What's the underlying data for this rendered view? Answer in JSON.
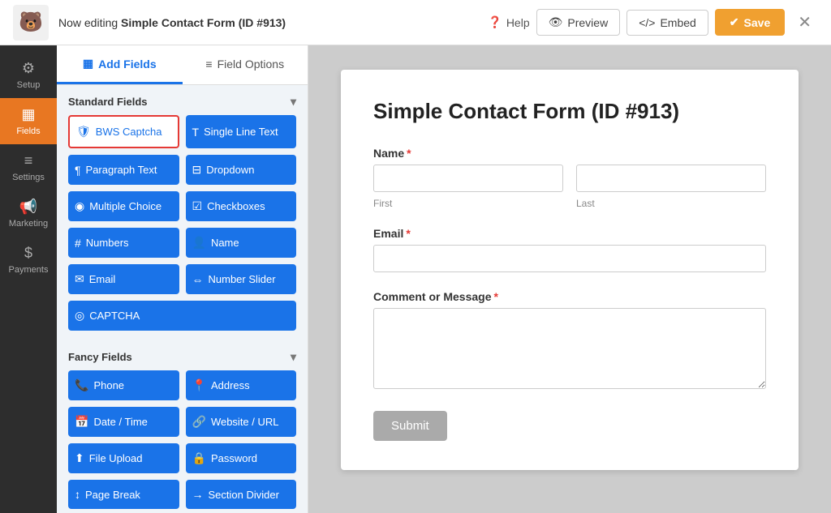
{
  "topbar": {
    "logo": "🐻",
    "editing_label": "Now editing",
    "form_name": "Simple Contact Form (ID #913)",
    "help_label": "Help",
    "preview_label": "Preview",
    "embed_label": "Embed",
    "save_label": "Save"
  },
  "sidebar_nav": {
    "items": [
      {
        "id": "setup",
        "label": "Setup",
        "icon": "⚙"
      },
      {
        "id": "fields",
        "label": "Fields",
        "icon": "▦",
        "active": true
      },
      {
        "id": "settings",
        "label": "Settings",
        "icon": "≡"
      },
      {
        "id": "marketing",
        "label": "Marketing",
        "icon": "📢"
      },
      {
        "id": "payments",
        "label": "Payments",
        "icon": "$"
      }
    ]
  },
  "panel": {
    "tabs": [
      {
        "id": "add-fields",
        "label": "Add Fields",
        "active": true
      },
      {
        "id": "field-options",
        "label": "Field Options"
      }
    ],
    "standard_fields_label": "Standard Fields",
    "fancy_fields_label": "Fancy Fields",
    "standard_fields": [
      {
        "id": "bws-captcha",
        "label": "BWS Captcha",
        "icon": "🛡",
        "selected": true
      },
      {
        "id": "single-line-text",
        "label": "Single Line Text",
        "icon": "T"
      },
      {
        "id": "paragraph-text",
        "label": "Paragraph Text",
        "icon": "¶"
      },
      {
        "id": "dropdown",
        "label": "Dropdown",
        "icon": "⊟"
      },
      {
        "id": "multiple-choice",
        "label": "Multiple Choice",
        "icon": "◉"
      },
      {
        "id": "checkboxes",
        "label": "Checkboxes",
        "icon": "☑"
      },
      {
        "id": "numbers",
        "label": "Numbers",
        "icon": "#"
      },
      {
        "id": "name",
        "label": "Name",
        "icon": "👤"
      },
      {
        "id": "email",
        "label": "Email",
        "icon": "✉"
      },
      {
        "id": "number-slider",
        "label": "Number Slider",
        "icon": "⇔"
      },
      {
        "id": "captcha",
        "label": "CAPTCHA",
        "icon": "◎",
        "full": true
      }
    ],
    "fancy_fields": [
      {
        "id": "phone",
        "label": "Phone",
        "icon": "📞"
      },
      {
        "id": "address",
        "label": "Address",
        "icon": "📍"
      },
      {
        "id": "date-time",
        "label": "Date / Time",
        "icon": "📅"
      },
      {
        "id": "website-url",
        "label": "Website / URL",
        "icon": "🔗"
      },
      {
        "id": "file-upload",
        "label": "File Upload",
        "icon": "⬆"
      },
      {
        "id": "password",
        "label": "Password",
        "icon": "🔒"
      },
      {
        "id": "page-break",
        "label": "Page Break",
        "icon": "↕"
      },
      {
        "id": "section-divider",
        "label": "Section Divider",
        "icon": "→"
      }
    ]
  },
  "form_preview": {
    "title": "Simple Contact Form (ID #913)",
    "fields": [
      {
        "id": "name-field",
        "label": "Name",
        "required": true,
        "type": "name",
        "sublabels": [
          "First",
          "Last"
        ]
      },
      {
        "id": "email-field",
        "label": "Email",
        "required": true,
        "type": "email"
      },
      {
        "id": "message-field",
        "label": "Comment or Message",
        "required": true,
        "type": "textarea"
      }
    ],
    "submit_label": "Submit"
  }
}
